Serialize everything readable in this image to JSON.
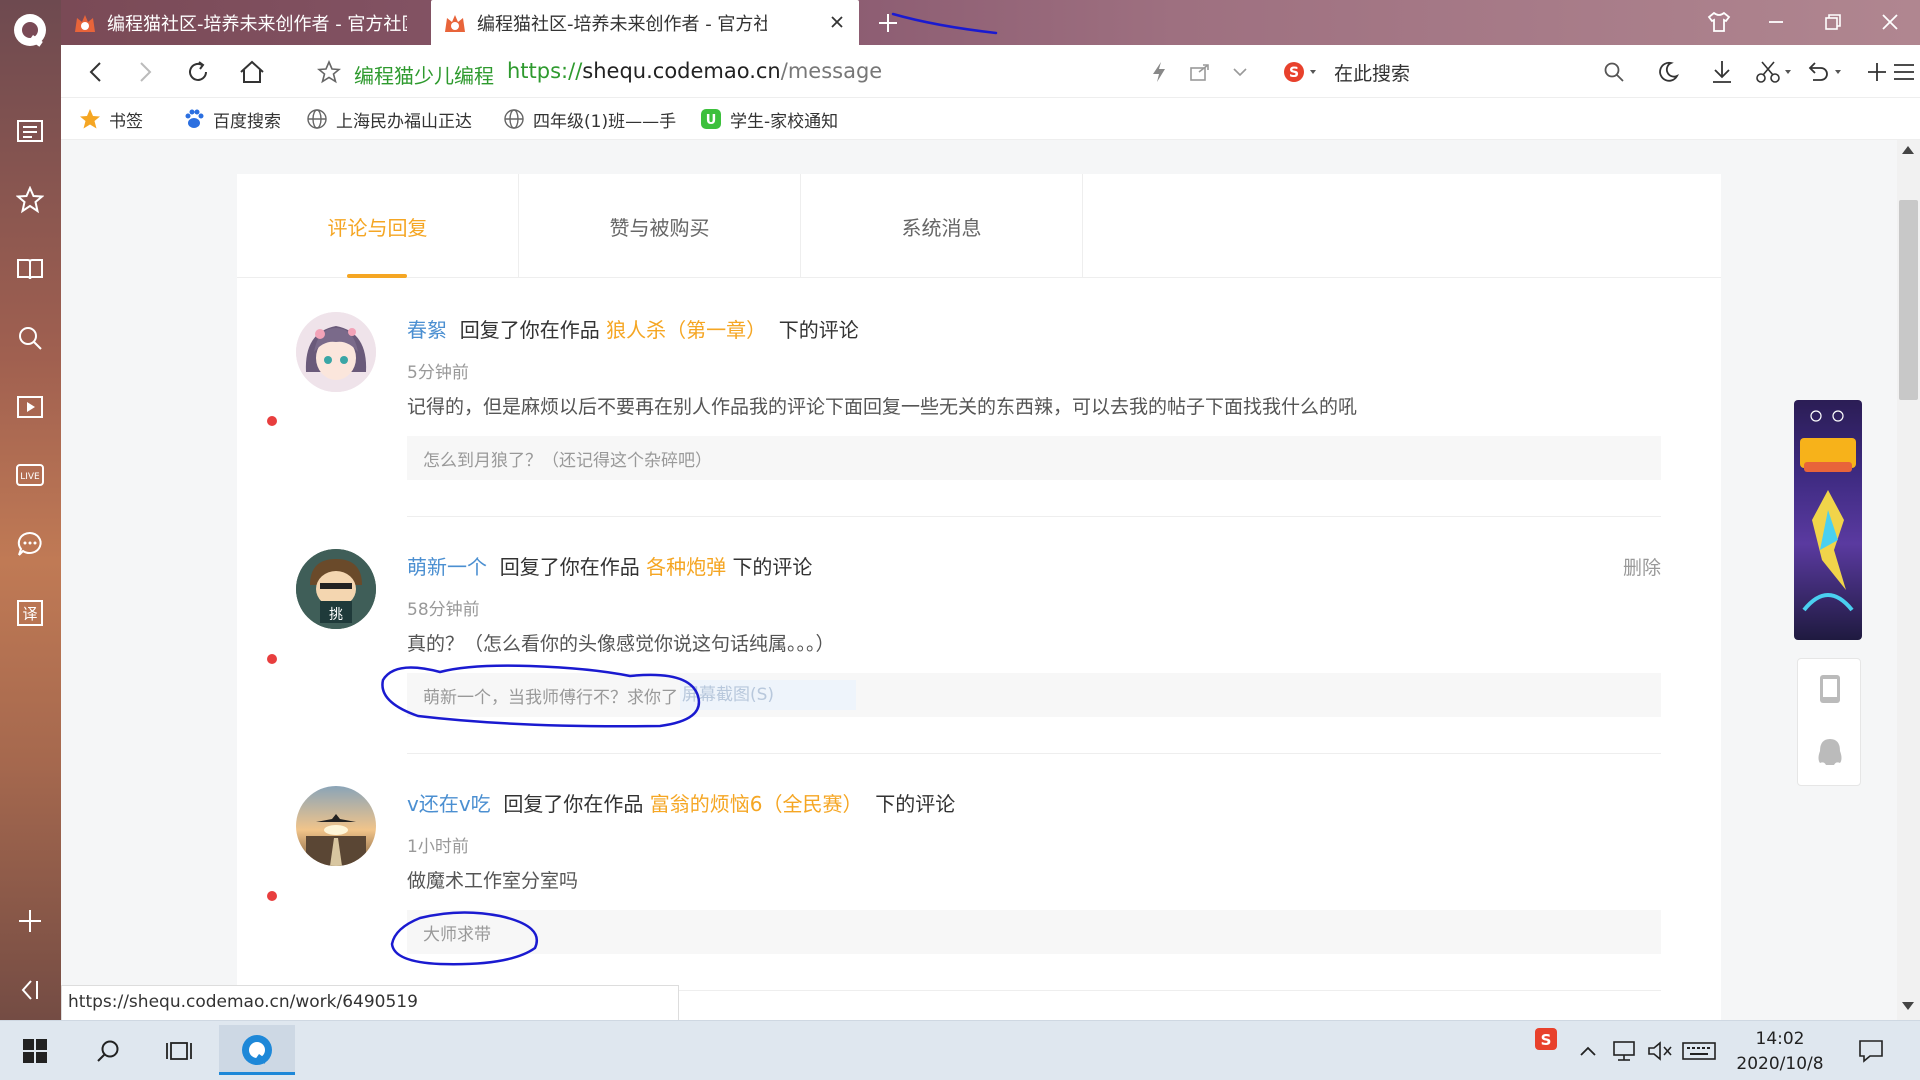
{
  "tabs": [
    {
      "title": "编程猫社区-培养未来创作者 - 官方社区",
      "active": false
    },
    {
      "title": "编程猫社区-培养未来创作者 - 官方社区",
      "active": true
    }
  ],
  "address": {
    "site_name": "编程猫少儿编程",
    "url_protocol": "https://",
    "url_host": "shequ.codemao.cn",
    "url_path": "/message",
    "search_placeholder": "在此搜索"
  },
  "bookmarks": [
    {
      "label": "书签",
      "icon": "star-icon"
    },
    {
      "label": "百度搜索",
      "icon": "baidu-paw-icon"
    },
    {
      "label": "上海民办福山正达",
      "icon": "globe-icon"
    },
    {
      "label": "四年级(1)班——手",
      "icon": "globe-icon"
    },
    {
      "label": "学生-家校通知",
      "icon": "app-u-icon"
    }
  ],
  "page_tabs": [
    {
      "label": "评论与回复",
      "active": true
    },
    {
      "label": "赞与被购买",
      "active": false
    },
    {
      "label": "系统消息",
      "active": false
    }
  ],
  "messages": [
    {
      "user": "春絮",
      "action": "回复了你在作品",
      "work": "狼人杀（第一章）",
      "suffix": "下的评论",
      "time": "5分钟前",
      "content": "记得的，但是麻烦以后不要再在别人作品我的评论下面回复一些无关的东西辣，可以去我的帖子下面找我什么的吼",
      "reply": "怎么到月狼了？（还记得这个杂碎吧）",
      "delete": ""
    },
    {
      "user": "萌新一个",
      "action": "回复了你在作品",
      "work": "各种炮弹",
      "suffix": "下的评论",
      "time": "58分钟前",
      "content": "真的？（怎么看你的头像感觉你说这句话纯属。。。）",
      "reply": "萌新一个，当我师傅行不？求你了",
      "reply_tooltip": "屏幕截图(S)",
      "delete": "删除"
    },
    {
      "user": "v还在v吃",
      "action": "回复了你在作品",
      "work": "富翁的烦恼6（全民赛）",
      "suffix": "下的评论",
      "time": "1小时前",
      "content": "做魔术工作室分室吗",
      "reply": "大师求带",
      "delete": ""
    }
  ],
  "status_link": "https://shequ.codemao.cn/work/6490519",
  "taskbar": {
    "time": "14:02",
    "date": "2020/10/8"
  },
  "colors": {
    "accent": "#f5a623",
    "user_link": "#4b8fd1",
    "site_green": "#2e9a2e",
    "unread_dot": "#e83e3e",
    "annotation": "#1a1ad0"
  }
}
